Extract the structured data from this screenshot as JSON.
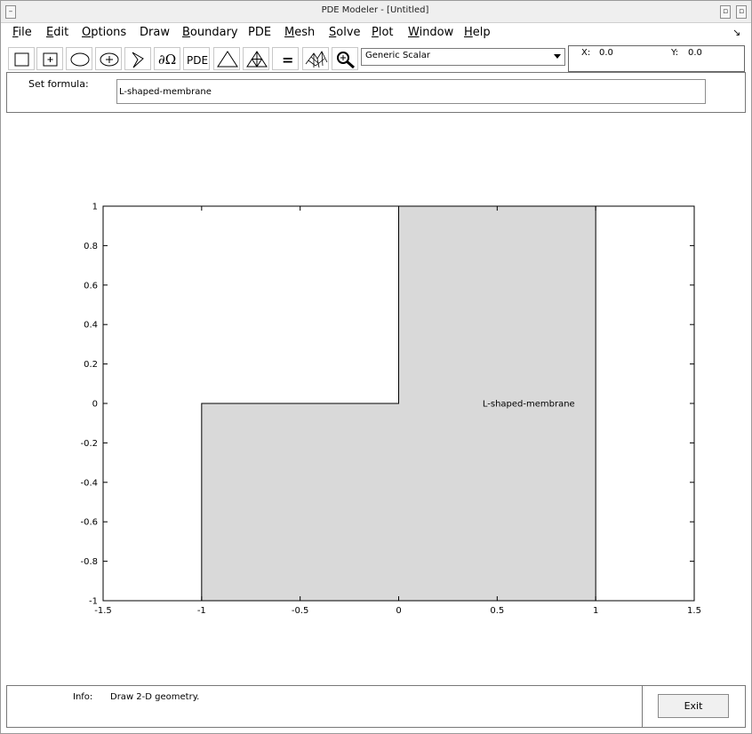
{
  "window": {
    "title": "PDE Modeler - [Untitled]"
  },
  "menu": [
    {
      "label": "File",
      "u": "F",
      "rest": "ile"
    },
    {
      "label": "Edit",
      "u": "E",
      "rest": "dit"
    },
    {
      "label": "Options",
      "u": "O",
      "rest": "ptions"
    },
    {
      "label": "Draw",
      "u": "",
      "rest": "Draw"
    },
    {
      "label": "Boundary",
      "u": "B",
      "rest": "oundary"
    },
    {
      "label": "PDE",
      "u": "",
      "rest": "PDE"
    },
    {
      "label": "Mesh",
      "u": "M",
      "rest": "esh"
    },
    {
      "label": "Solve",
      "u": "S",
      "rest": "olve"
    },
    {
      "label": "Plot",
      "u": "P",
      "rest": "lot"
    },
    {
      "label": "Window",
      "u": "W",
      "rest": "indow"
    },
    {
      "label": "Help",
      "u": "H",
      "rest": "elp"
    }
  ],
  "toolbar": {
    "pde_label": "PDE",
    "equals_label": "=",
    "boundary_label": "∂Ω",
    "application_mode": "Generic Scalar"
  },
  "coords": {
    "x_label": "X:",
    "x_value": "0.0",
    "y_label": "Y:",
    "y_value": "0.0"
  },
  "formula": {
    "label": "Set formula:",
    "value": "L-shaped-membrane"
  },
  "chart_data": {
    "type": "geometry",
    "shape_label": "L-shaped-membrane",
    "polygon": [
      [
        -1,
        -1
      ],
      [
        1,
        -1
      ],
      [
        1,
        1
      ],
      [
        0,
        1
      ],
      [
        0,
        0
      ],
      [
        -1,
        0
      ]
    ],
    "xlim": [
      -1.5,
      1.5
    ],
    "ylim": [
      -1,
      1
    ],
    "x_ticks": [
      "-1.5",
      "-1",
      "-0.5",
      "0",
      "0.5",
      "1",
      "1.5"
    ],
    "y_ticks": [
      "1",
      "0.8",
      "0.6",
      "0.4",
      "0.2",
      "0",
      "-0.2",
      "-0.4",
      "-0.6",
      "-0.8",
      "-1"
    ],
    "fill_color": "#d9d9d9"
  },
  "info": {
    "label": "Info:",
    "text": "Draw 2-D geometry."
  },
  "exit_label": "Exit"
}
